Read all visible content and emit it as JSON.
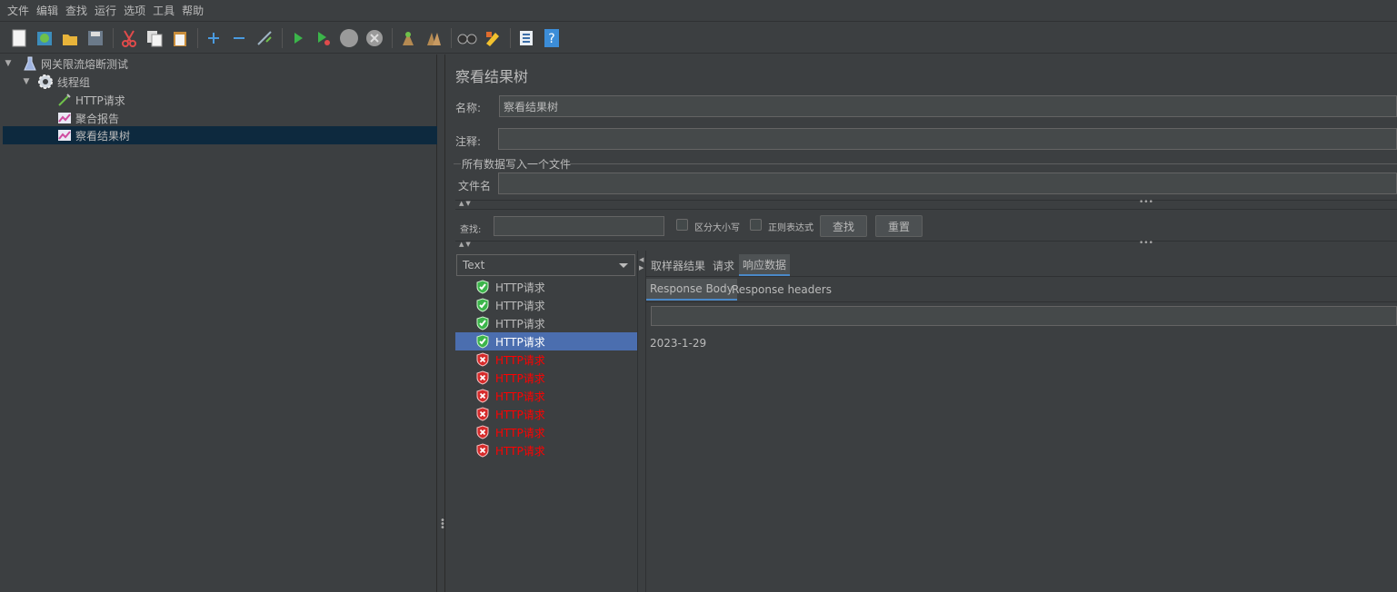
{
  "menu": [
    "文件",
    "编辑",
    "查找",
    "运行",
    "选项",
    "工具",
    "帮助"
  ],
  "toolbar": {
    "icons": [
      "new-icon",
      "templates-icon",
      "open-icon",
      "save-icon",
      "cut-icon",
      "copy-icon",
      "paste-icon",
      "expand-icon",
      "collapse-icon",
      "toggle-icon",
      "start-icon",
      "start-no-pause-icon",
      "stop-icon",
      "shutdown-icon",
      "clear-icon",
      "clear-all-icon",
      "search-icon",
      "reset-search-icon",
      "function-helper-icon",
      "help-icon"
    ]
  },
  "tree": {
    "items": [
      {
        "label": "网关限流熔断测试",
        "icon": "test-plan-icon"
      },
      {
        "label": "线程组",
        "icon": "thread-group-icon"
      },
      {
        "label": "HTTP请求",
        "icon": "http-sampler-icon"
      },
      {
        "label": "聚合报告",
        "icon": "listener-icon"
      },
      {
        "label": "察看结果树",
        "icon": "listener-icon"
      }
    ]
  },
  "panel": {
    "title": "察看结果树",
    "name_label": "名称:",
    "name_value": "察看结果树",
    "comment_label": "注释:",
    "comment_value": "",
    "file_group": "所有数据写入一个文件",
    "filename_label": "文件名",
    "filename_value": ""
  },
  "search": {
    "label": "查找:",
    "value": "",
    "case_label": "区分大小写",
    "regex_label": "正则表达式",
    "find_button": "查找",
    "reset_button": "重置"
  },
  "renderer": {
    "selected": "Text"
  },
  "results": [
    {
      "label": "HTTP请求",
      "status": "ok"
    },
    {
      "label": "HTTP请求",
      "status": "ok"
    },
    {
      "label": "HTTP请求",
      "status": "ok"
    },
    {
      "label": "HTTP请求",
      "status": "ok"
    },
    {
      "label": "HTTP请求",
      "status": "err"
    },
    {
      "label": "HTTP请求",
      "status": "err"
    },
    {
      "label": "HTTP请求",
      "status": "err"
    },
    {
      "label": "HTTP请求",
      "status": "err"
    },
    {
      "label": "HTTP请求",
      "status": "err"
    },
    {
      "label": "HTTP请求",
      "status": "err"
    }
  ],
  "tabs": [
    "取样器结果",
    "请求",
    "响应数据"
  ],
  "subtabs": [
    "Response Body",
    "Response headers"
  ],
  "response_body": "2023-1-29",
  "colors": {
    "accent": "#4a88c7",
    "selected_result": "#4b6eaf",
    "error": "#ff0000",
    "ok": "#3bb54a"
  }
}
